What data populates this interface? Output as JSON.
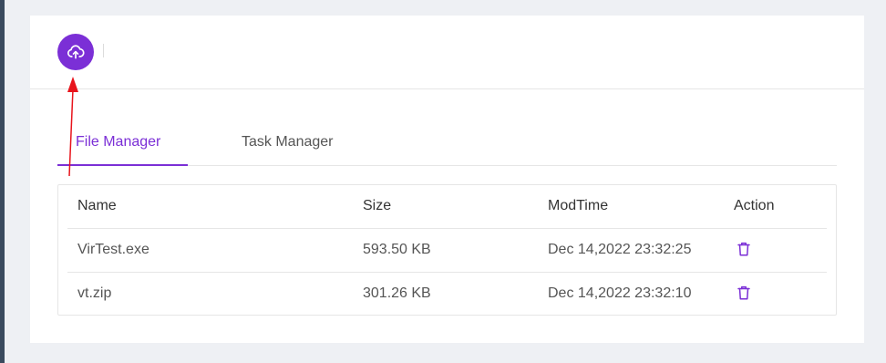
{
  "upload": {
    "icon": "cloud-upload-icon",
    "color": "#7b2fd6"
  },
  "tabs": [
    {
      "label": "File Manager",
      "active": true
    },
    {
      "label": "Task Manager",
      "active": false
    }
  ],
  "table": {
    "columns": [
      "Name",
      "Size",
      "ModTime",
      "Action"
    ],
    "rows": [
      {
        "name": "VirTest.exe",
        "size": "593.50 KB",
        "modtime": "Dec 14,2022 23:32:25",
        "action_icon": "trash-icon"
      },
      {
        "name": "vt.zip",
        "size": "301.26 KB",
        "modtime": "Dec 14,2022 23:32:10",
        "action_icon": "trash-icon"
      }
    ]
  },
  "colors": {
    "accent": "#7b2fd6",
    "annotation_arrow": "#e8141c"
  }
}
